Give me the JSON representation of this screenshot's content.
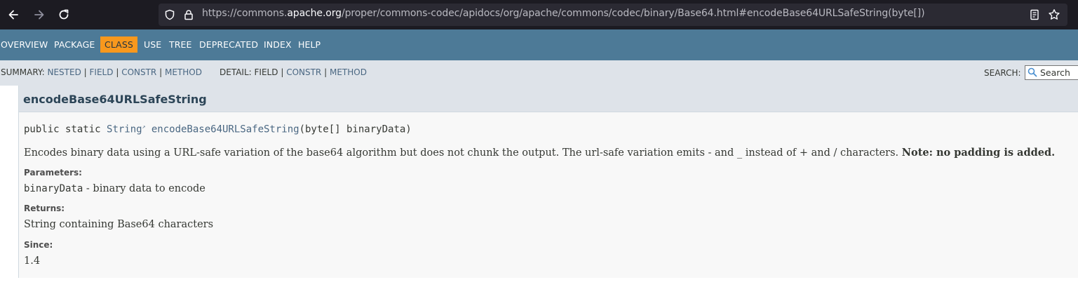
{
  "browser": {
    "url_prefix": "https://commons.",
    "url_domain": "apache.org",
    "url_path": "/proper/commons-codec/apidocs/org/apache/commons/codec/binary/Base64.html#encodeBase64URLSafeString(byte[])"
  },
  "topnav": {
    "items": [
      "OVERVIEW",
      "PACKAGE",
      "CLASS",
      "USE",
      "TREE",
      "DEPRECATED",
      "INDEX",
      "HELP"
    ],
    "active": "CLASS"
  },
  "subnav": {
    "summary_label": "SUMMARY:",
    "summary_links": [
      "NESTED",
      "FIELD",
      "CONSTR",
      "METHOD"
    ],
    "detail_label": "DETAIL:",
    "detail_field": "FIELD",
    "detail_links": [
      "CONSTR",
      "METHOD"
    ],
    "separator": "|",
    "search_label": "SEARCH:",
    "search_placeholder": "Search"
  },
  "member": {
    "title": "encodeBase64URLSafeString",
    "signature_modifiers": "public static ",
    "signature_return": "String",
    "signature_name": "encodeBase64URLSafeString",
    "signature_params": "(byte[] binaryData)",
    "description": "Encodes binary data using a URL-safe variation of the base64 algorithm but does not chunk the output. The url-safe variation emits - and _ instead of + and / characters. ",
    "description_note": "Note: no padding is added.",
    "parameters_label": "Parameters:",
    "param_name": "binaryData",
    "param_desc": " - binary data to encode",
    "returns_label": "Returns:",
    "returns_desc": "String containing Base64 characters",
    "since_label": "Since:",
    "since_value": "1.4"
  },
  "colors": {
    "topnav_bg": "#4d7a97",
    "active_tab": "#f8981d",
    "link": "#4a6782"
  }
}
